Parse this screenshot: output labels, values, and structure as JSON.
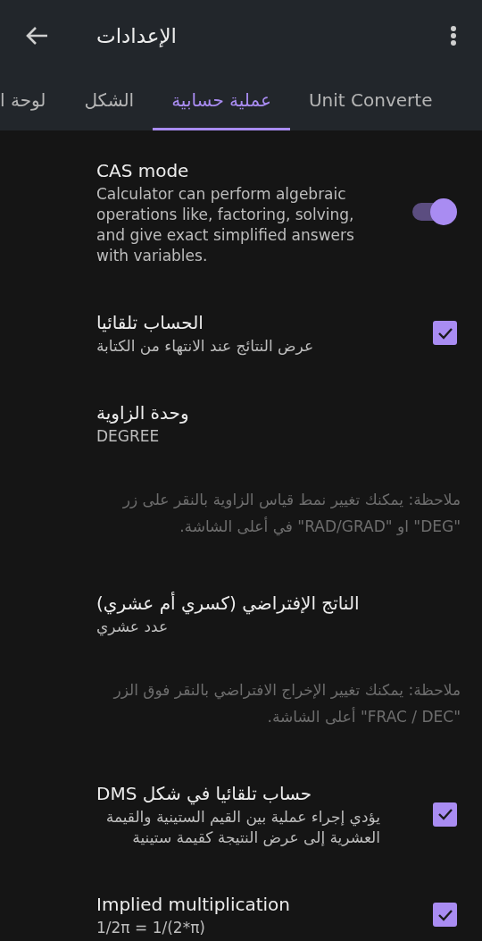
{
  "app_bar": {
    "title": "الإعدادات"
  },
  "tabs": [
    {
      "label": "Unit Converte",
      "selected": false
    },
    {
      "label": "عملية حسابية",
      "selected": true
    },
    {
      "label": "الشكل",
      "selected": false
    },
    {
      "label": "لوحة ا",
      "selected": false
    }
  ],
  "settings": [
    {
      "kind": "switch",
      "title": "CAS mode",
      "summary": "Calculator can perform algebraic operations like, factoring, solving, and give exact simplified answers with variables.",
      "on": true
    },
    {
      "kind": "checkbox",
      "title": "الحساب تلقائيا",
      "summary": "عرض النتائج عند الانتهاء من الكتابة",
      "checked": true
    },
    {
      "kind": "value",
      "title": "وحدة الزاوية",
      "summary": "DEGREE"
    },
    {
      "kind": "note",
      "text": "ملاحظة: يمكنك تغيير نمط قياس الزاوية بالنقر على زر \"DEG\" او \"RAD/GRAD\" في أعلى الشاشة."
    },
    {
      "kind": "value",
      "title": "الناتج الإفتراضي (كسري أم عشري)",
      "summary": "عدد عشري"
    },
    {
      "kind": "note",
      "text": "ملاحظة: يمكنك تغيير الإخراج الافتراضي بالنقر فوق الزر \"FRAC / DEC\" أعلى الشاشة."
    },
    {
      "kind": "checkbox",
      "title": "حساب تلقائيا في شكل DMS",
      "summary": "يؤدي إجراء عملية بين القيم الستينية والقيمة العشرية إلى عرض النتيجة كقيمة ستينية",
      "checked": true
    },
    {
      "kind": "checkbox",
      "title": "Implied multiplication",
      "summary": "1/2π = 1/(2*π)",
      "checked": true
    }
  ]
}
